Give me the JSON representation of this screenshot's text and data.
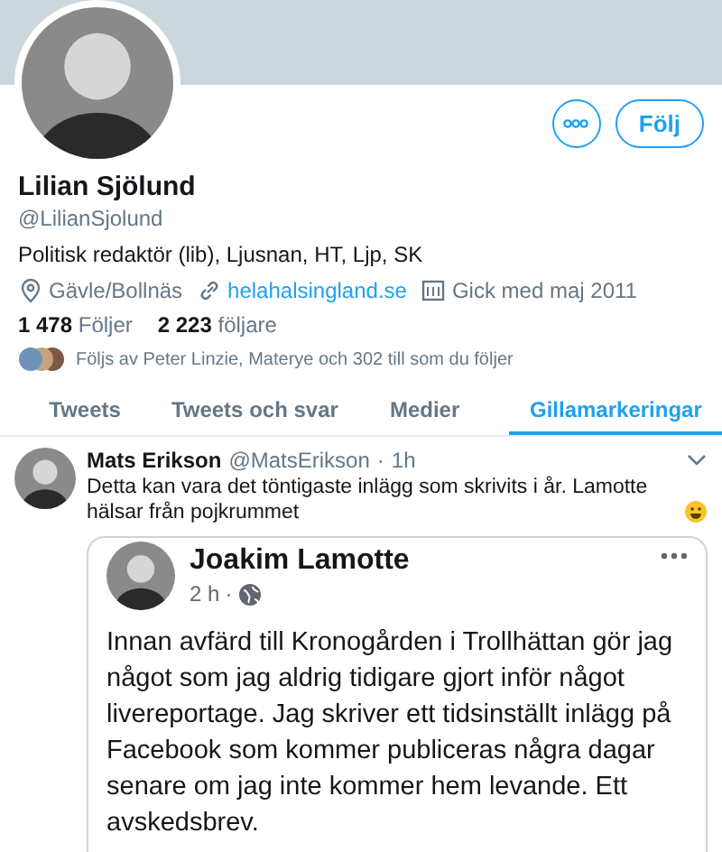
{
  "profile": {
    "name": "Lilian Sjölund",
    "handle": "@LilianSjolund",
    "bio": "Politisk redaktör (lib), Ljusnan, HT, Ljp, SK",
    "meta": [
      {
        "kind": "location",
        "text": "Gävle/Bollnäs"
      },
      {
        "kind": "link",
        "text": "helahalsingland.se"
      },
      {
        "kind": "joined",
        "text": "Gick med maj 2011"
      }
    ],
    "stats": [
      "**1 478** Följer",
      "**2 223** följare"
    ],
    "followed_by": "Följs av Peter Linzie, Materye och 302 till som du följer",
    "follow_button": "Följ"
  },
  "tabs": [
    {
      "label": "Tweets",
      "selected": false
    },
    {
      "label": "Tweets och svar",
      "selected": false
    },
    {
      "label": "Medier",
      "selected": false
    },
    {
      "label": "Gillamarkeringar",
      "selected": true
    }
  ],
  "tweet": {
    "name": "Mats Erikson",
    "handle": "@MatsErikson",
    "separator": "·",
    "time": "1h",
    "text": "Detta kan vara det töntigaste inlägg som skrivits i år. Lamotte hälsar från pojkrummet",
    "embed": {
      "name": "Joakim Lamotte",
      "time": "2 h",
      "separator": "·",
      "text": "Innan avfärd till Kronogården i Trollhättan gör jag något som jag aldrig tidigare gjort inför något livereportage. Jag skriver ett tidsinställt inlägg på Facebook som kommer publiceras några dagar senare om jag inte kommer hem levande. Ett avskedsbrev."
    }
  }
}
